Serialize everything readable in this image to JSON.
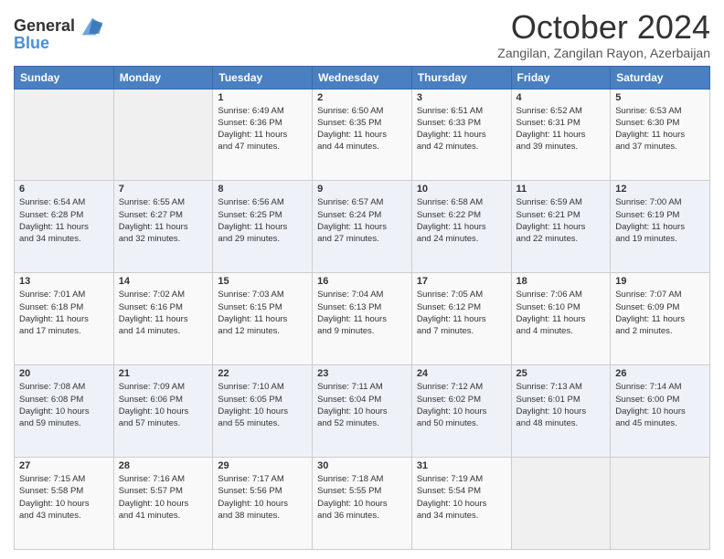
{
  "logo": {
    "line1": "General",
    "line2": "Blue"
  },
  "title": "October 2024",
  "subtitle": "Zangilan, Zangilan Rayon, Azerbaijan",
  "days_header": [
    "Sunday",
    "Monday",
    "Tuesday",
    "Wednesday",
    "Thursday",
    "Friday",
    "Saturday"
  ],
  "weeks": [
    [
      {
        "day": "",
        "text": ""
      },
      {
        "day": "",
        "text": ""
      },
      {
        "day": "1",
        "text": "Sunrise: 6:49 AM\nSunset: 6:36 PM\nDaylight: 11 hours\nand 47 minutes."
      },
      {
        "day": "2",
        "text": "Sunrise: 6:50 AM\nSunset: 6:35 PM\nDaylight: 11 hours\nand 44 minutes."
      },
      {
        "day": "3",
        "text": "Sunrise: 6:51 AM\nSunset: 6:33 PM\nDaylight: 11 hours\nand 42 minutes."
      },
      {
        "day": "4",
        "text": "Sunrise: 6:52 AM\nSunset: 6:31 PM\nDaylight: 11 hours\nand 39 minutes."
      },
      {
        "day": "5",
        "text": "Sunrise: 6:53 AM\nSunset: 6:30 PM\nDaylight: 11 hours\nand 37 minutes."
      }
    ],
    [
      {
        "day": "6",
        "text": "Sunrise: 6:54 AM\nSunset: 6:28 PM\nDaylight: 11 hours\nand 34 minutes."
      },
      {
        "day": "7",
        "text": "Sunrise: 6:55 AM\nSunset: 6:27 PM\nDaylight: 11 hours\nand 32 minutes."
      },
      {
        "day": "8",
        "text": "Sunrise: 6:56 AM\nSunset: 6:25 PM\nDaylight: 11 hours\nand 29 minutes."
      },
      {
        "day": "9",
        "text": "Sunrise: 6:57 AM\nSunset: 6:24 PM\nDaylight: 11 hours\nand 27 minutes."
      },
      {
        "day": "10",
        "text": "Sunrise: 6:58 AM\nSunset: 6:22 PM\nDaylight: 11 hours\nand 24 minutes."
      },
      {
        "day": "11",
        "text": "Sunrise: 6:59 AM\nSunset: 6:21 PM\nDaylight: 11 hours\nand 22 minutes."
      },
      {
        "day": "12",
        "text": "Sunrise: 7:00 AM\nSunset: 6:19 PM\nDaylight: 11 hours\nand 19 minutes."
      }
    ],
    [
      {
        "day": "13",
        "text": "Sunrise: 7:01 AM\nSunset: 6:18 PM\nDaylight: 11 hours\nand 17 minutes."
      },
      {
        "day": "14",
        "text": "Sunrise: 7:02 AM\nSunset: 6:16 PM\nDaylight: 11 hours\nand 14 minutes."
      },
      {
        "day": "15",
        "text": "Sunrise: 7:03 AM\nSunset: 6:15 PM\nDaylight: 11 hours\nand 12 minutes."
      },
      {
        "day": "16",
        "text": "Sunrise: 7:04 AM\nSunset: 6:13 PM\nDaylight: 11 hours\nand 9 minutes."
      },
      {
        "day": "17",
        "text": "Sunrise: 7:05 AM\nSunset: 6:12 PM\nDaylight: 11 hours\nand 7 minutes."
      },
      {
        "day": "18",
        "text": "Sunrise: 7:06 AM\nSunset: 6:10 PM\nDaylight: 11 hours\nand 4 minutes."
      },
      {
        "day": "19",
        "text": "Sunrise: 7:07 AM\nSunset: 6:09 PM\nDaylight: 11 hours\nand 2 minutes."
      }
    ],
    [
      {
        "day": "20",
        "text": "Sunrise: 7:08 AM\nSunset: 6:08 PM\nDaylight: 10 hours\nand 59 minutes."
      },
      {
        "day": "21",
        "text": "Sunrise: 7:09 AM\nSunset: 6:06 PM\nDaylight: 10 hours\nand 57 minutes."
      },
      {
        "day": "22",
        "text": "Sunrise: 7:10 AM\nSunset: 6:05 PM\nDaylight: 10 hours\nand 55 minutes."
      },
      {
        "day": "23",
        "text": "Sunrise: 7:11 AM\nSunset: 6:04 PM\nDaylight: 10 hours\nand 52 minutes."
      },
      {
        "day": "24",
        "text": "Sunrise: 7:12 AM\nSunset: 6:02 PM\nDaylight: 10 hours\nand 50 minutes."
      },
      {
        "day": "25",
        "text": "Sunrise: 7:13 AM\nSunset: 6:01 PM\nDaylight: 10 hours\nand 48 minutes."
      },
      {
        "day": "26",
        "text": "Sunrise: 7:14 AM\nSunset: 6:00 PM\nDaylight: 10 hours\nand 45 minutes."
      }
    ],
    [
      {
        "day": "27",
        "text": "Sunrise: 7:15 AM\nSunset: 5:58 PM\nDaylight: 10 hours\nand 43 minutes."
      },
      {
        "day": "28",
        "text": "Sunrise: 7:16 AM\nSunset: 5:57 PM\nDaylight: 10 hours\nand 41 minutes."
      },
      {
        "day": "29",
        "text": "Sunrise: 7:17 AM\nSunset: 5:56 PM\nDaylight: 10 hours\nand 38 minutes."
      },
      {
        "day": "30",
        "text": "Sunrise: 7:18 AM\nSunset: 5:55 PM\nDaylight: 10 hours\nand 36 minutes."
      },
      {
        "day": "31",
        "text": "Sunrise: 7:19 AM\nSunset: 5:54 PM\nDaylight: 10 hours\nand 34 minutes."
      },
      {
        "day": "",
        "text": ""
      },
      {
        "day": "",
        "text": ""
      }
    ]
  ]
}
